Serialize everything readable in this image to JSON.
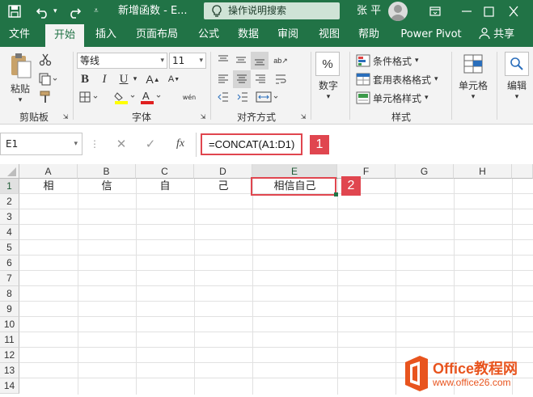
{
  "titlebar": {
    "doc_title": "新增函数 - E...",
    "search_placeholder": "操作说明搜索",
    "user_name": "张 平"
  },
  "tabs": [
    {
      "label": "文件",
      "active": false
    },
    {
      "label": "开始",
      "active": true
    },
    {
      "label": "插入",
      "active": false
    },
    {
      "label": "页面布局",
      "active": false
    },
    {
      "label": "公式",
      "active": false
    },
    {
      "label": "数据",
      "active": false
    },
    {
      "label": "审阅",
      "active": false
    },
    {
      "label": "视图",
      "active": false
    },
    {
      "label": "帮助",
      "active": false
    },
    {
      "label": "Power Pivot",
      "active": false
    }
  ],
  "share_label": "共享",
  "ribbon": {
    "paste_label": "粘贴",
    "clipboard_group": "剪贴板",
    "font_name": "等线",
    "font_size": "11",
    "font_group": "字体",
    "wen_label": "wén",
    "align_group": "对齐方式",
    "number_label": "数字",
    "cond_format": "条件格式",
    "table_format": "套用表格格式",
    "cell_style": "单元格样式",
    "style_group": "样式",
    "cells_label": "单元格",
    "edit_label": "编辑"
  },
  "formula": {
    "name_box": "E1",
    "fx": "fx",
    "value": "=CONCAT(A1:D1)",
    "badge1": "1"
  },
  "sheet": {
    "columns": [
      "A",
      "B",
      "C",
      "D",
      "E",
      "F",
      "G",
      "H"
    ],
    "rows": [
      "1",
      "2",
      "3",
      "4",
      "5",
      "6",
      "7",
      "8",
      "9",
      "10",
      "11",
      "12",
      "13",
      "14"
    ],
    "row1": [
      "相",
      "信",
      "自",
      "己",
      "相信自己"
    ],
    "badge2": "2"
  },
  "watermark": {
    "brand": "Office教程网",
    "url": "www.office26.com"
  }
}
